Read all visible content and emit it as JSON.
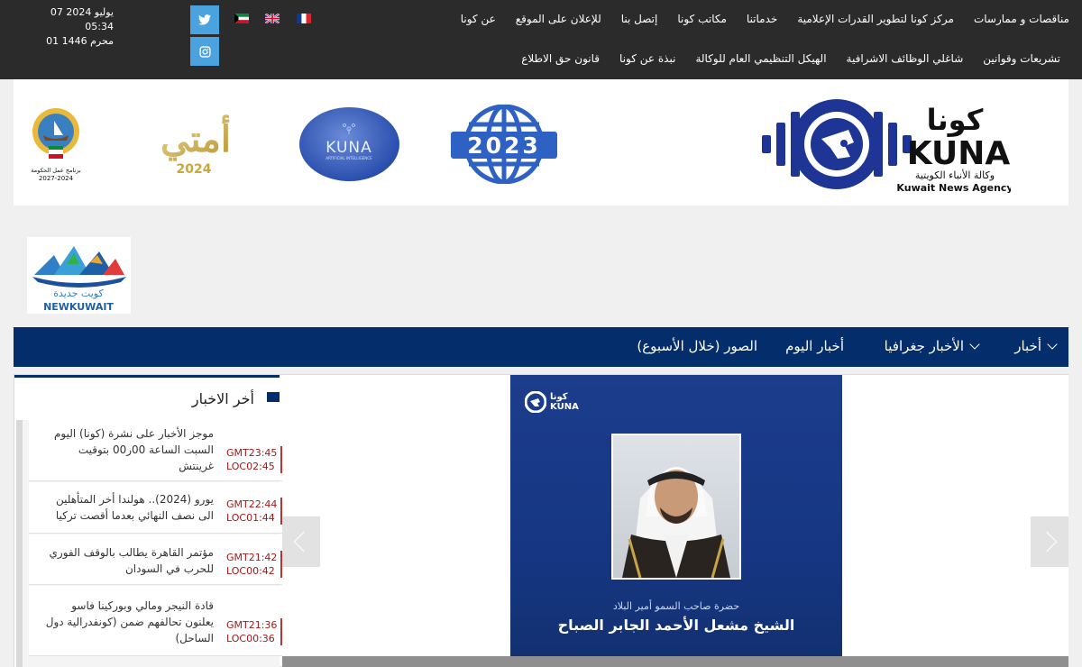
{
  "topbar": {
    "nav_row1": [
      "عن كونا",
      "للإعلان على الموقع",
      "إتصل بنا",
      "مكاتب كونا",
      "خدماتنا",
      "مركز كونا لتطوير القدرات الإعلامية",
      "مناقصات و ممارسات"
    ],
    "nav_row2": [
      "قانون حق الاطلاع",
      "نبذة عن كونا",
      "الهيكل التنظيمي العام للوكالة",
      "شاغلي الوظائف الاشرافية",
      "تشريعات وقوانين"
    ],
    "date_gregorian": "07 يوليو 2024 05:34",
    "date_hijri": "01 محرم 1446",
    "social": [
      "twitter-icon",
      "instagram-icon"
    ],
    "languages": [
      "kuwait-flag",
      "uk-flag",
      "france-flag"
    ]
  },
  "banner": {
    "kuna_arabic": "كونا",
    "kuna_latin": "KUNA",
    "agency_arabic": "وكالة الأنباء الكويتية",
    "agency_english": "Kuwait News Agency",
    "badge_2023": "2023",
    "kuna_ai_text": "KUNA",
    "kuna_ai_sub": "ARTIFICIAL INTELLIGENCE",
    "ommati_text": "أمتي",
    "ommati_year": "2024",
    "gov_program": "برنامج عمل الحكومة",
    "gov_years": "2027-2024",
    "newkuwait_ar": "كويت جديدة",
    "newkuwait_en": "NEWKUWAIT"
  },
  "mainnav": {
    "items": [
      "أخبار",
      "الأخبار جغرافيا",
      "أخبار اليوم",
      "الصور (خلال الأسبوع)"
    ]
  },
  "latest": {
    "title": "أخر الاخبار",
    "items": [
      {
        "text": "موجز الأخبار على نشرة (كونا) اليوم السبت الساعة 00ر00 بتوقيت غرينتش",
        "gmt": "GMT23:45",
        "loc": "LOC02:45"
      },
      {
        "text": "يورو (2024).. هولندا أخر المتأهلين الى نصف النهائي بعدما أقصت تركيا",
        "gmt": "GMT22:44",
        "loc": "LOC01:44"
      },
      {
        "text": "مؤتمر القاهرة يطالب بالوقف الفوري للحرب في السودان",
        "gmt": "GMT21:42",
        "loc": "LOC00:42"
      },
      {
        "text": "قادة النيجر ومالي وبوركينا فاسو يعلنون تحالفهم ضمن (كونفدرالية دول الساحل)",
        "gmt": "GMT21:36",
        "loc": "LOC00:36"
      }
    ]
  },
  "slider": {
    "logo_ar": "كونا",
    "logo_en": "KUNA",
    "caption_small": "حضرة صاحب السمو أمير البلاد",
    "caption_big": "الشيخ مشعل الأحمد الجابر الصباح"
  }
}
